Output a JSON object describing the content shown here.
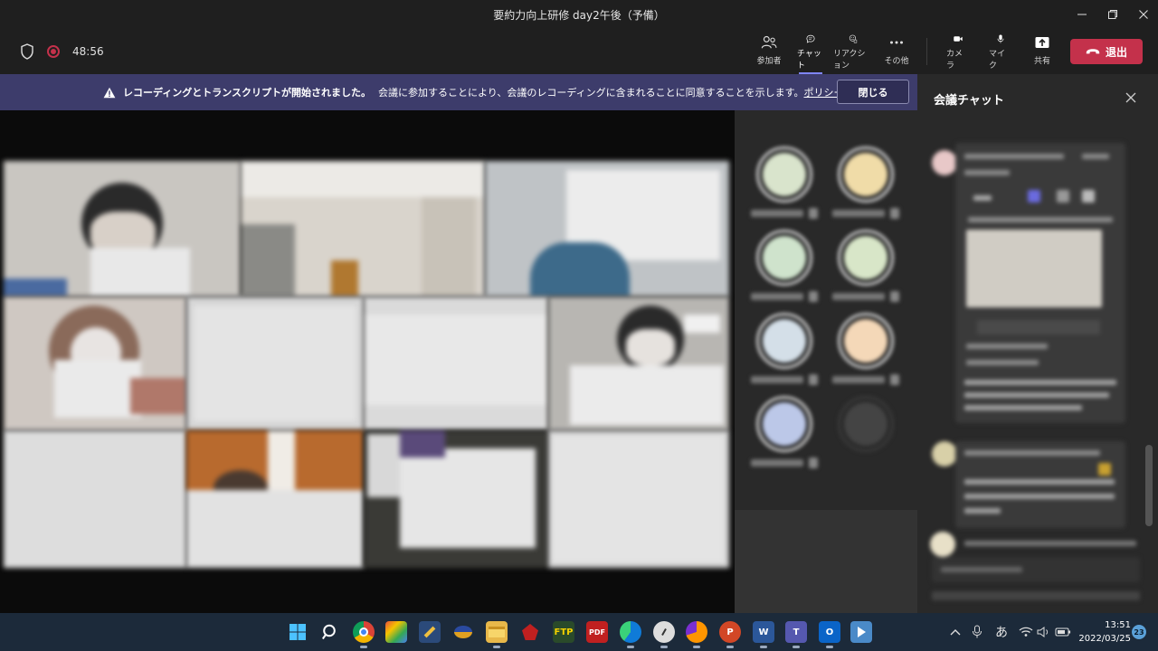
{
  "window": {
    "title": "要約力向上研修 day2午後（予備）"
  },
  "toolbar": {
    "elapsed_time": "48:56",
    "buttons": {
      "participants": "参加者",
      "chat": "チャット",
      "reactions": "リアクション",
      "more": "その他",
      "camera": "カメラ",
      "mic": "マイク",
      "share": "共有",
      "leave": "退出"
    }
  },
  "banner": {
    "headline": "レコーディングとトランスクリプトが開始されました。",
    "message": "会議に参加することにより、会議のレコーディングに含まれることに同意することを示します。",
    "link": "ポリシー",
    "close_label": "閉じる"
  },
  "chat_panel": {
    "title": "会議チャット"
  },
  "taskbar": {
    "ime_label": "あ",
    "time": "13:51",
    "date": "2022/03/25",
    "notification_count": "23"
  },
  "colors": {
    "accent": "#7f85f5",
    "leave_red": "#c4314b",
    "banner_bg": "#3d3c6b",
    "taskbar_bg": "#1c2a3a"
  },
  "icons": {
    "security": "shield-icon",
    "recording": "record-dot-icon",
    "participants": "people-icon",
    "chat": "chat-bubble-icon",
    "reactions": "smiley-hand-icon",
    "more": "ellipsis-icon",
    "camera": "video-camera-icon",
    "mic": "microphone-icon",
    "share": "share-tray-icon",
    "leave": "phone-hangup-icon",
    "warning": "warning-triangle-icon"
  }
}
